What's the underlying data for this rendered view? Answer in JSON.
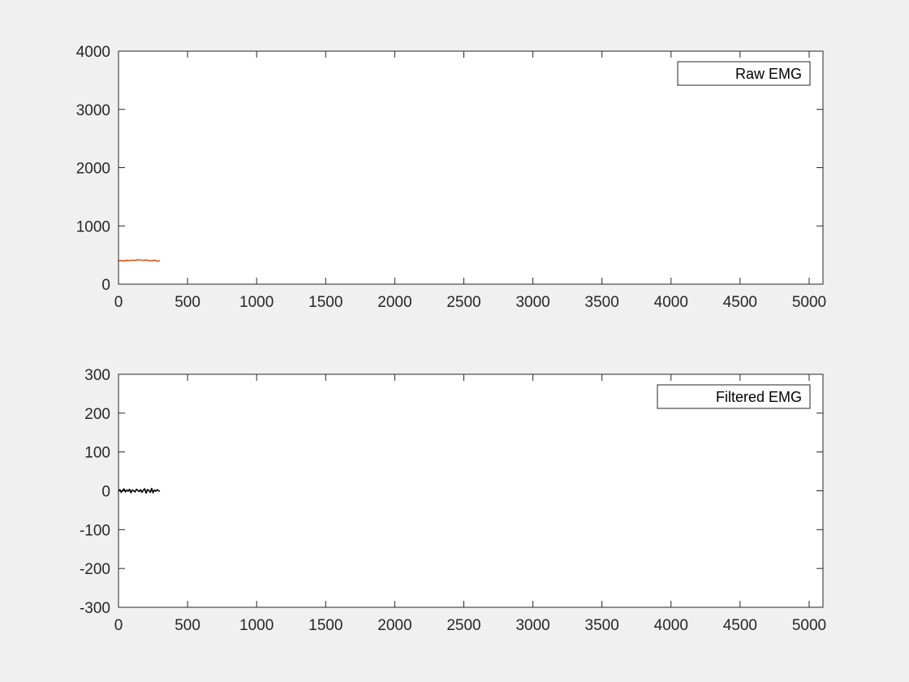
{
  "figure": {
    "background": "#f0f0f0"
  },
  "chart_data": [
    {
      "type": "line",
      "title": "",
      "xlabel": "",
      "ylabel": "",
      "xlim": [
        0,
        5100
      ],
      "ylim": [
        0,
        4000
      ],
      "xticks": [
        0,
        500,
        1000,
        1500,
        2000,
        2500,
        3000,
        3500,
        4000,
        4500,
        5000
      ],
      "yticks": [
        0,
        1000,
        2000,
        3000,
        4000
      ],
      "xtick_labels": [
        "0",
        "500",
        "1000",
        "1500",
        "2000",
        "2500",
        "3000",
        "3500",
        "4000",
        "4500",
        "5000"
      ],
      "ytick_labels": [
        "0",
        "1000",
        "2000",
        "3000",
        "4000"
      ],
      "grid": false,
      "legend": {
        "position": "top-right",
        "entries": [
          "Raw EMG"
        ]
      },
      "series": [
        {
          "name": "Raw EMG",
          "color": "#d95319",
          "x": [
            0,
            20,
            40,
            60,
            80,
            100,
            120,
            140,
            160,
            180,
            200,
            220,
            240,
            260,
            280,
            300
          ],
          "y": [
            400,
            405,
            398,
            410,
            404,
            412,
            407,
            420,
            413,
            409,
            416,
            405,
            398,
            412,
            395,
            402
          ]
        }
      ]
    },
    {
      "type": "line",
      "title": "",
      "xlabel": "",
      "ylabel": "",
      "xlim": [
        0,
        5100
      ],
      "ylim": [
        -300,
        300
      ],
      "xticks": [
        0,
        500,
        1000,
        1500,
        2000,
        2500,
        3000,
        3500,
        4000,
        4500,
        5000
      ],
      "yticks": [
        -300,
        -200,
        -100,
        0,
        100,
        200,
        300
      ],
      "xtick_labels": [
        "0",
        "500",
        "1000",
        "1500",
        "2000",
        "2500",
        "3000",
        "3500",
        "4000",
        "4500",
        "5000"
      ],
      "ytick_labels": [
        "-300",
        "-200",
        "-100",
        "0",
        "100",
        "200",
        "300"
      ],
      "grid": false,
      "legend": {
        "position": "top-right",
        "entries": [
          "Filtered EMG"
        ]
      },
      "series": [
        {
          "name": "Filtered EMG",
          "color": "#000000",
          "x": [
            0,
            10,
            20,
            30,
            40,
            50,
            60,
            70,
            80,
            90,
            100,
            110,
            120,
            130,
            140,
            150,
            160,
            170,
            180,
            190,
            200,
            210,
            220,
            230,
            240,
            250,
            260,
            270,
            280,
            290,
            300
          ],
          "y": [
            -2,
            3,
            -4,
            1,
            5,
            -3,
            2,
            -1,
            4,
            -5,
            2,
            0,
            -3,
            4,
            1,
            -2,
            3,
            -4,
            2,
            5,
            -6,
            3,
            1,
            -4,
            6,
            -5,
            2,
            -1,
            3,
            0,
            -1
          ]
        }
      ]
    }
  ]
}
